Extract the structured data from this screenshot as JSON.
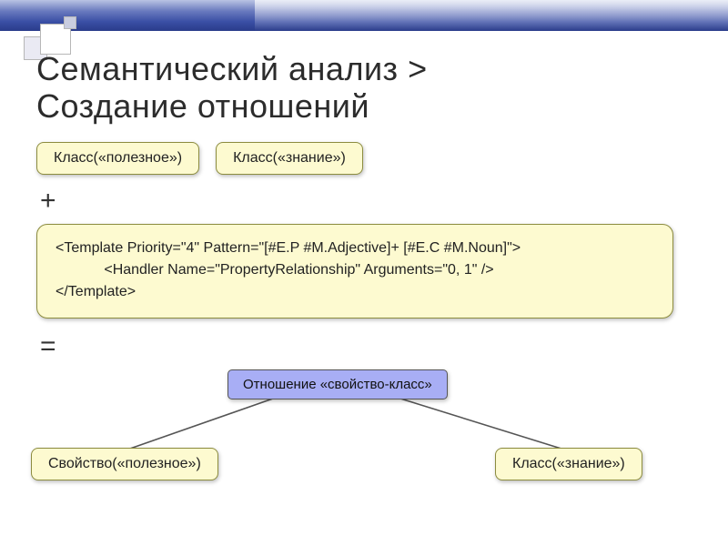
{
  "title_line1": "Семантический анализ >",
  "title_line2": "Создание отношений",
  "top_boxes": {
    "left": "Класс(«полезное»)",
    "right": "Класс(«знание»)"
  },
  "op_plus": "+",
  "code": {
    "line1": "<Template Priority=\"4\" Pattern=\"[#E.P #M.Adjective]+ [#E.C #M.Noun]\">",
    "line2": "            <Handler Name=\"PropertyRelationship\" Arguments=\"0, 1\" />",
    "line3": "</Template>"
  },
  "op_equals": "=",
  "relation": {
    "title": "Отношение «свойство-класс»",
    "left": "Свойство(«полезное»)",
    "right": "Класс(«знание»)"
  }
}
